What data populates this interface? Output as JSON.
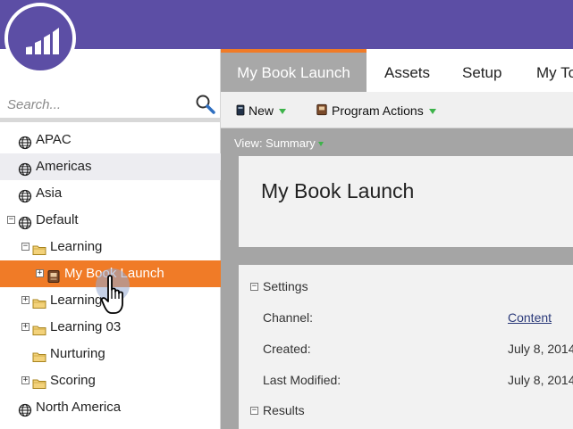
{
  "search": {
    "placeholder": "Search..."
  },
  "tree": [
    {
      "label": "APAC",
      "icon": "globe-icon"
    },
    {
      "label": "Americas",
      "icon": "globe-icon"
    },
    {
      "label": "Asia",
      "icon": "globe-icon"
    },
    {
      "label": "Default",
      "icon": "globe-icon"
    },
    {
      "label": "Learning",
      "icon": "folder-icon"
    },
    {
      "label": "My Book Launch",
      "icon": "program-icon"
    },
    {
      "label": "Learning",
      "icon": "folder-icon"
    },
    {
      "label": "Learning 03",
      "icon": "folder-icon"
    },
    {
      "label": "Nurturing",
      "icon": "folder-icon"
    },
    {
      "label": "Scoring",
      "icon": "folder-icon"
    },
    {
      "label": "North America",
      "icon": "globe-icon"
    }
  ],
  "tabs": [
    "My Book Launch",
    "Assets",
    "Setup",
    "My To"
  ],
  "toolbar": {
    "new_label": "New",
    "program_actions_label": "Program Actions"
  },
  "view": {
    "label": "View: Summary"
  },
  "program": {
    "title": "My Book Launch"
  },
  "settings": {
    "heading": "Settings",
    "channel_label": "Channel:",
    "channel_value": "Content",
    "created_label": "Created:",
    "created_value": "July 8, 2014",
    "modified_label": "Last Modified:",
    "modified_value": "July 8, 2014"
  },
  "results": {
    "heading": "Results"
  },
  "colors": {
    "brand": "#5c4ea5",
    "accent": "#f07b27",
    "dropdown": "#3db34a"
  }
}
